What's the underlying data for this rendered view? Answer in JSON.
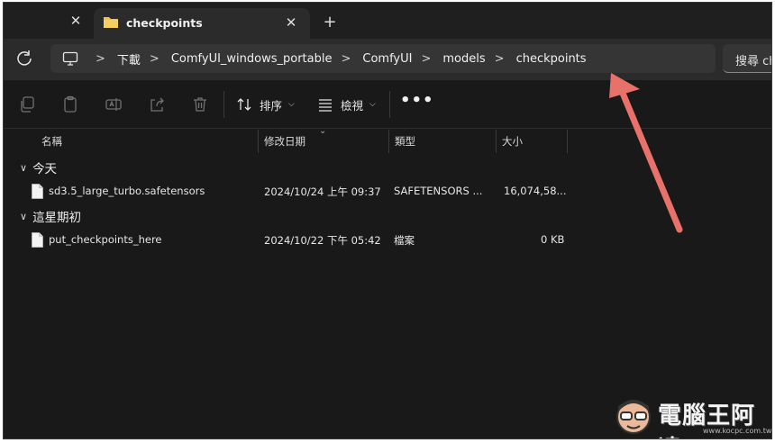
{
  "tabs": {
    "active_title": "checkpoints",
    "close_symbol": "✕",
    "new_tab_symbol": "+"
  },
  "address": {
    "crumbs": [
      "下載",
      "ComfyUI_windows_portable",
      "ComfyUI",
      "models",
      "checkpoints"
    ],
    "separator": ">"
  },
  "search": {
    "placeholder": "搜尋 ch"
  },
  "toolbar": {
    "sort_label": "排序",
    "view_label": "檢視",
    "more_label": "•••"
  },
  "columns": {
    "name": "名稱",
    "modified": "修改日期",
    "type": "類型",
    "size": "大小"
  },
  "groups": [
    {
      "label": "今天",
      "files": [
        {
          "name": "sd3.5_large_turbo.safetensors",
          "modified": "2024/10/24 上午 09:37",
          "type": "SAFETENSORS ...",
          "size": "16,074,58..."
        }
      ]
    },
    {
      "label": "這星期初",
      "files": [
        {
          "name": "put_checkpoints_here",
          "modified": "2024/10/22 下午 05:42",
          "type": "檔案",
          "size": "0 KB"
        }
      ]
    }
  ],
  "watermark": {
    "title": "電腦王阿達",
    "url": "www.kocpc.com.tw"
  },
  "colors": {
    "background": "#191919",
    "tab_active": "#2b2b2b",
    "folder": "#f2c14e",
    "annotation_arrow": "#e8716a"
  }
}
